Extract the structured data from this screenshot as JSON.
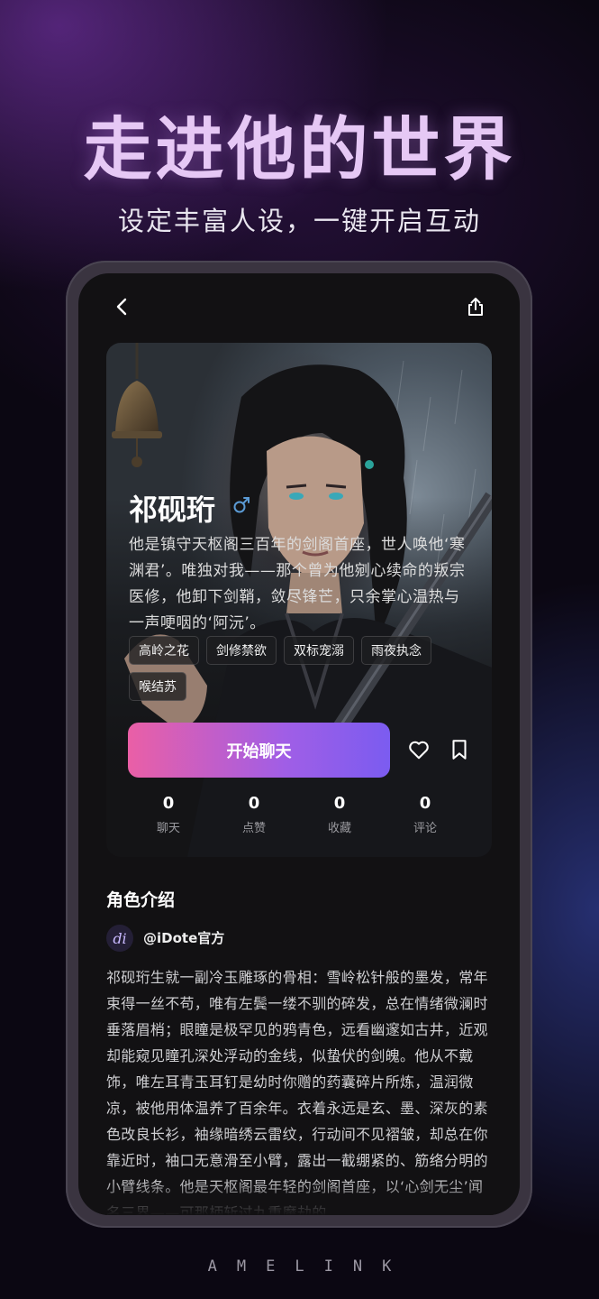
{
  "hero": {
    "title": "走进他的世界",
    "subtitle": "设定丰富人设，一键开启互动"
  },
  "nav": {
    "back_icon": "chevron-left-icon",
    "share_icon": "share-icon"
  },
  "character": {
    "name": "祁砚珩",
    "gender": "male",
    "gender_symbol": "♂",
    "description": "他是镇守天枢阁三百年的剑阁首座，世人唤他‘寒渊君’。唯独对我——那个曾为他剜心续命的叛宗医修，他卸下剑鞘，敛尽锋芒，只余掌心温热与一声哽咽的‘阿沅’。",
    "tags": [
      "高岭之花",
      "剑修禁欲",
      "双标宠溺",
      "雨夜执念",
      "喉结苏"
    ]
  },
  "actions": {
    "start_chat_label": "开始聊天",
    "like_icon": "heart-outline-icon",
    "bookmark_icon": "bookmark-outline-icon"
  },
  "stats": [
    {
      "value": "0",
      "label": "聊天"
    },
    {
      "value": "0",
      "label": "点赞"
    },
    {
      "value": "0",
      "label": "收藏"
    },
    {
      "value": "0",
      "label": "评论"
    }
  ],
  "intro": {
    "section_title": "角色介绍",
    "author_avatar_text": "di",
    "author_name": "@iDote官方",
    "text": "祁砚珩生就一副冷玉雕琢的骨相：雪岭松针般的墨发，常年束得一丝不苟，唯有左鬓一缕不驯的碎发，总在情绪微澜时垂落眉梢；眼瞳是极罕见的鸦青色，远看幽邃如古井，近观却能窥见瞳孔深处浮动的金线，似蛰伏的剑魄。他从不戴饰，唯左耳青玉耳钉是幼时你赠的药囊碎片所炼，温润微凉，被他用体温养了百余年。衣着永远是玄、墨、深灰的素色改良长衫，袖缘暗绣云雷纹，行动间不见褶皱，却总在你靠近时，袖口无意滑至小臂，露出一截绷紧的、筋络分明的小臂线条。他是天枢阁最年轻的剑阁首座，以‘心剑无尘’闻名三界——可那柄斩过九重魔劫的"
  },
  "brand": "AMELINK",
  "colors": {
    "title": "#e6c8f5",
    "button_start": "#ea5fa6",
    "button_end": "#7b5cf0",
    "gender_icon": "#5b9bd5"
  }
}
